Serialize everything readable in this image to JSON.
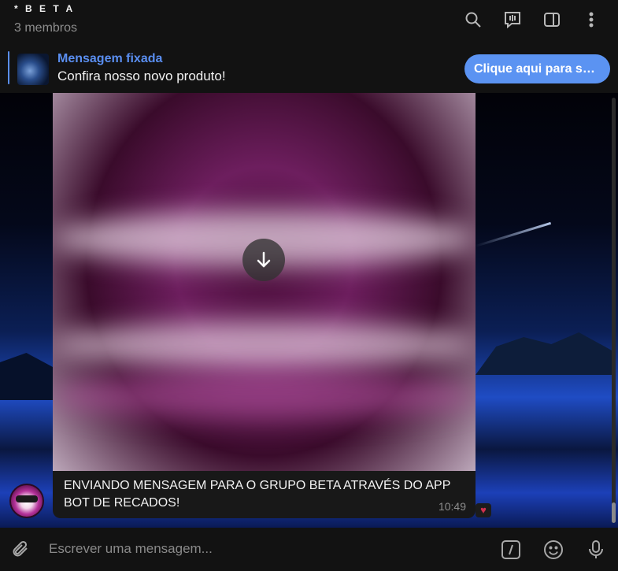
{
  "header": {
    "title": "* B E T A",
    "subtitle": "3 membros",
    "icons": [
      "search-icon",
      "live-chat-icon",
      "sidebar-toggle-icon",
      "more-vert-icon"
    ]
  },
  "pinned": {
    "title": "Mensagem fixada",
    "text": "Confira nosso novo produto!",
    "button_label": "Clique aqui para saber mais"
  },
  "message": {
    "caption": "ENVIANDO MENSAGEM PARA O GRUPO BETA ATRAVÉS DO APP BOT DE RECADOS!",
    "time": "10:49",
    "reaction": "♥",
    "download_icon": "download-arrow-icon"
  },
  "composer": {
    "placeholder": "Escrever uma mensagem...",
    "icons": [
      "attach-icon",
      "bot-command-icon",
      "emoji-icon",
      "microphone-icon"
    ]
  },
  "colors": {
    "accent": "#5b93f2",
    "header_bg": "#121212",
    "bubble_bg": "#181818"
  }
}
